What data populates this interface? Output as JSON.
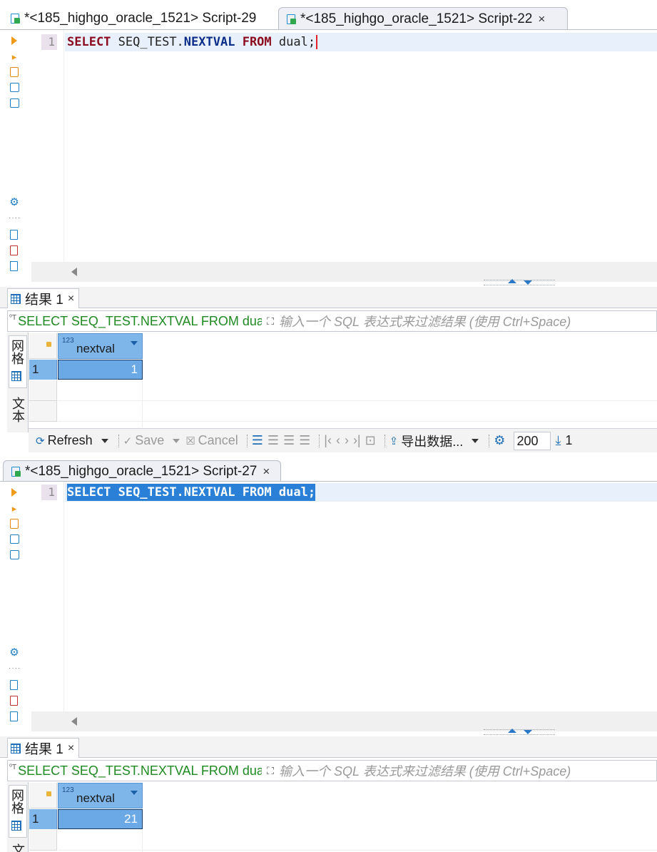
{
  "top_tabs": [
    {
      "label": "*<185_highgo_oracle_1521> Script-29",
      "active": false
    },
    {
      "label": "*<185_highgo_oracle_1521> Script-22",
      "active": true,
      "close": "×"
    }
  ],
  "bottom_tabs": [
    {
      "label": "*<185_highgo_oracle_1521> Script-27",
      "active": true,
      "close": "×"
    }
  ],
  "editor1": {
    "line_number": "1",
    "tokens": [
      "SELECT",
      "SEQ_TEST.",
      "NEXTVAL",
      "FROM",
      "dual;"
    ]
  },
  "editor2": {
    "line_number": "1",
    "tokens": [
      "SELECT",
      "SEQ_TEST.",
      "NEXTVAL",
      "FROM",
      "dual;"
    ]
  },
  "results1": {
    "tab_label": "结果 1",
    "close": "×",
    "filter_sql": "SELECT SEQ_TEST.NEXTVAL FROM dua",
    "filter_placeholder": "输入一个 SQL 表达式来过滤结果 (使用 Ctrl+Space)",
    "side_tabs": [
      "网格",
      "文本"
    ],
    "column_type": "123",
    "column_name": "nextval",
    "rows": [
      {
        "num": "1",
        "value": "1"
      }
    ]
  },
  "results2": {
    "tab_label": "结果 1",
    "close": "×",
    "filter_sql": "SELECT SEQ_TEST.NEXTVAL FROM dua",
    "filter_placeholder": "输入一个 SQL 表达式来过滤结果 (使用 Ctrl+Space)",
    "side_tabs": [
      "网格",
      "文本"
    ],
    "column_type": "123",
    "column_name": "nextval",
    "rows": [
      {
        "num": "1",
        "value": "21"
      }
    ]
  },
  "toolbar": {
    "refresh": "Refresh",
    "save": "Save",
    "cancel": "Cancel",
    "export": "导出数据...",
    "fetch_size": "200",
    "row_count": "1"
  },
  "colors": {
    "selection": "#2a7fd6",
    "header_blue": "#7fb6ea",
    "keyword_red": "#8b0a1f",
    "keyword_navy": "#0c2e8a",
    "filter_green": "#1f8a22"
  }
}
